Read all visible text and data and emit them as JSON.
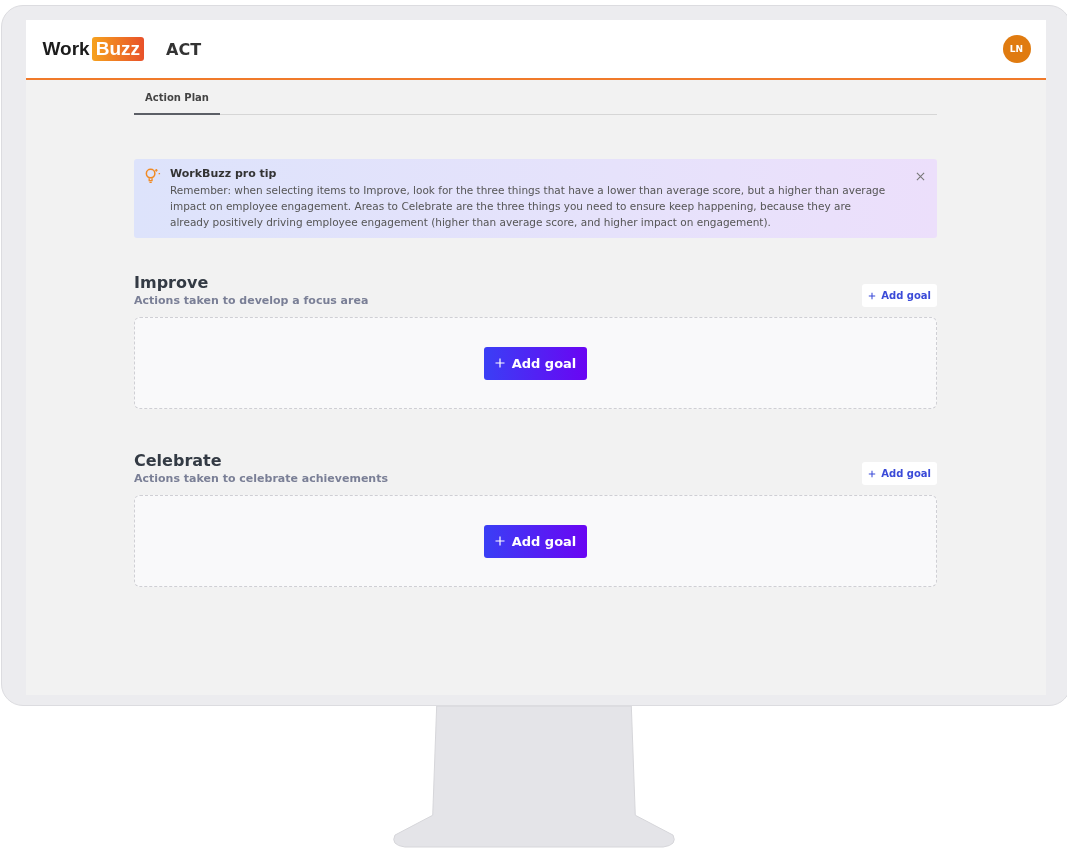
{
  "header": {
    "logo": {
      "first": "Work",
      "second": "Buzz"
    },
    "app_name": "ACT",
    "avatar": "LN"
  },
  "tabs": [
    {
      "label": "Action Plan",
      "selected": true
    }
  ],
  "tip": {
    "title": "WorkBuzz pro tip",
    "text": "Remember: when selecting items to Improve, look for the three things that have a lower than average score, but a higher than average impact on employee engagement. Areas to Celebrate are the three things you need to ensure keep happening, because they are already positively driving employee engagement (higher than average score, and higher impact on engagement)."
  },
  "sections": [
    {
      "title": "Improve",
      "subtitle": "Actions taken to develop a focus area",
      "header_button": "Add goal",
      "empty_button": "Add goal"
    },
    {
      "title": "Celebrate",
      "subtitle": "Actions taken to celebrate achievements",
      "header_button": "Add goal",
      "empty_button": "Add goal"
    }
  ]
}
